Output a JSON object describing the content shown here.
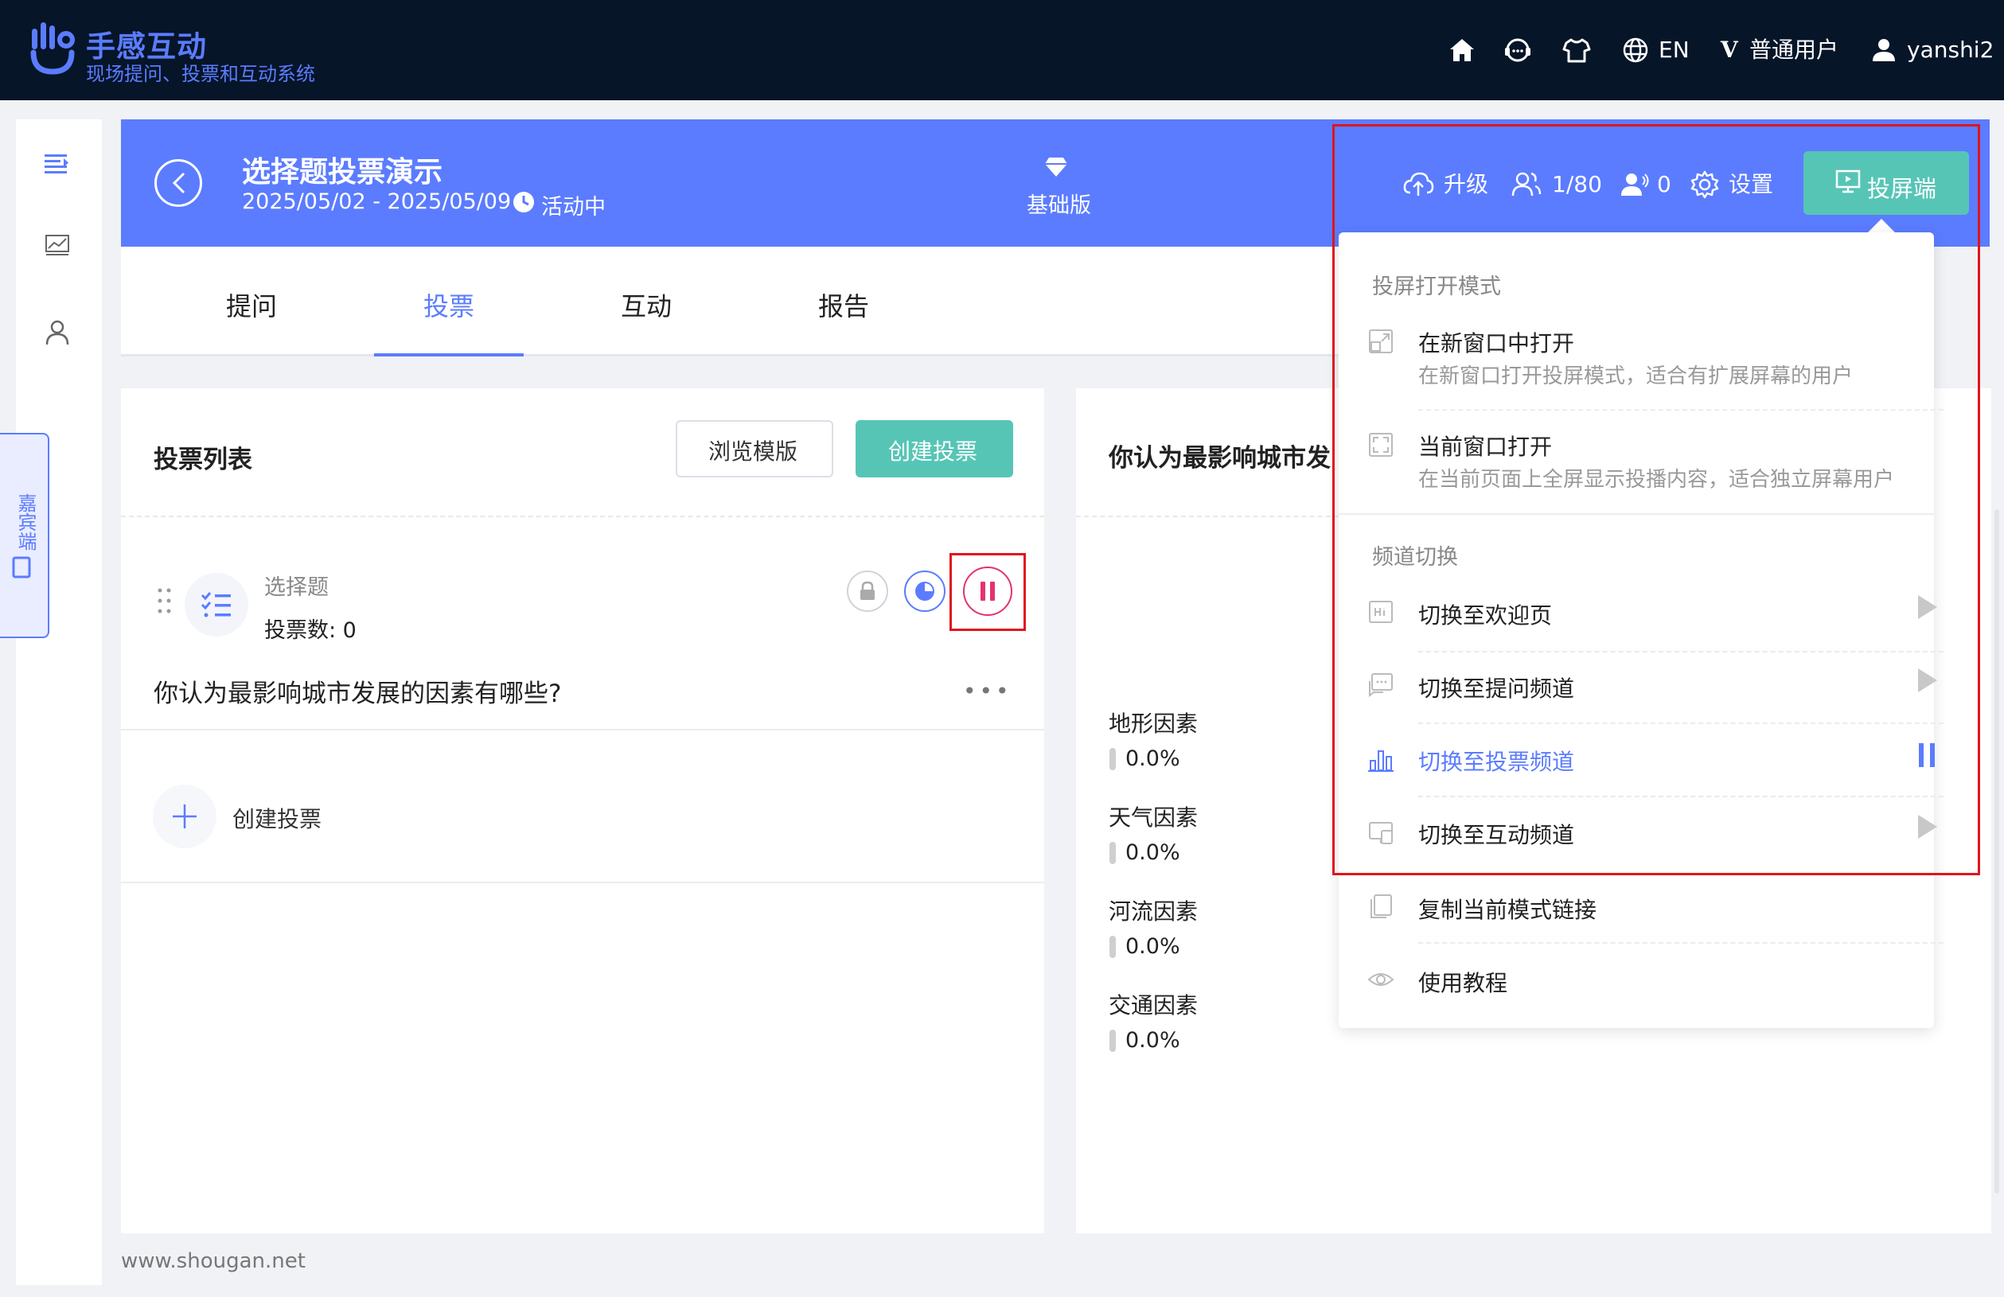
{
  "app": {
    "logo_title": "手感互动",
    "logo_subtitle": "现场提问、投票和互动系统",
    "brand_color": "#5b7cff",
    "accent_color": "#56c5b6"
  },
  "topnav": {
    "language": "EN",
    "plan_letter": "V",
    "user_type": "普通用户",
    "username": "yanshi2",
    "icons": [
      "home-icon",
      "support-icon",
      "shirt-icon",
      "globe-icon",
      "user-icon"
    ]
  },
  "sidebar": {
    "icons": [
      "menu-icon",
      "chart-icon",
      "person-icon"
    ],
    "guest_tab": "嘉宾端"
  },
  "event": {
    "title": "选择题投票演示",
    "date_range": "2025/05/02 - 2025/05/09",
    "status": "活动中",
    "plan": "基础版",
    "upgrade": "升级",
    "participants": "1/80",
    "online": "0",
    "settings": "设置",
    "screen_button": "投屏端"
  },
  "tabs": [
    "提问",
    "投票",
    "互动",
    "报告"
  ],
  "active_tab": "投票",
  "vote_list": {
    "title": "投票列表",
    "browse_templates": "浏览模版",
    "create_vote": "创建投票",
    "item": {
      "type": "选择题",
      "count_label": "投票数: 0",
      "question": "你认为最影响城市发展的因素有哪些?"
    },
    "add_label": "创建投票"
  },
  "result": {
    "title": "你认为最影响城市发",
    "options": [
      {
        "label": "地形因素",
        "pct": "0.0%"
      },
      {
        "label": "天气因素",
        "pct": "0.0%"
      },
      {
        "label": "河流因素",
        "pct": "0.0%"
      },
      {
        "label": "交通因素",
        "pct": "0.0%"
      }
    ]
  },
  "dropdown": {
    "mode_section": "投屏打开模式",
    "new_window": "在新窗口中打开",
    "new_window_desc": "在新窗口打开投屏模式，适合有扩展屏幕的用户",
    "current_window": "当前窗口打开",
    "current_window_desc": "在当前页面上全屏显示投播内容，适合独立屏幕用户",
    "channel_section": "频道切换",
    "welcome": "切换至欢迎页",
    "qa": "切换至提问频道",
    "vote": "切换至投票频道",
    "interact": "切换至互动频道",
    "copy_link": "复制当前模式链接",
    "tutorial": "使用教程"
  },
  "footer": "www.shougan.net"
}
